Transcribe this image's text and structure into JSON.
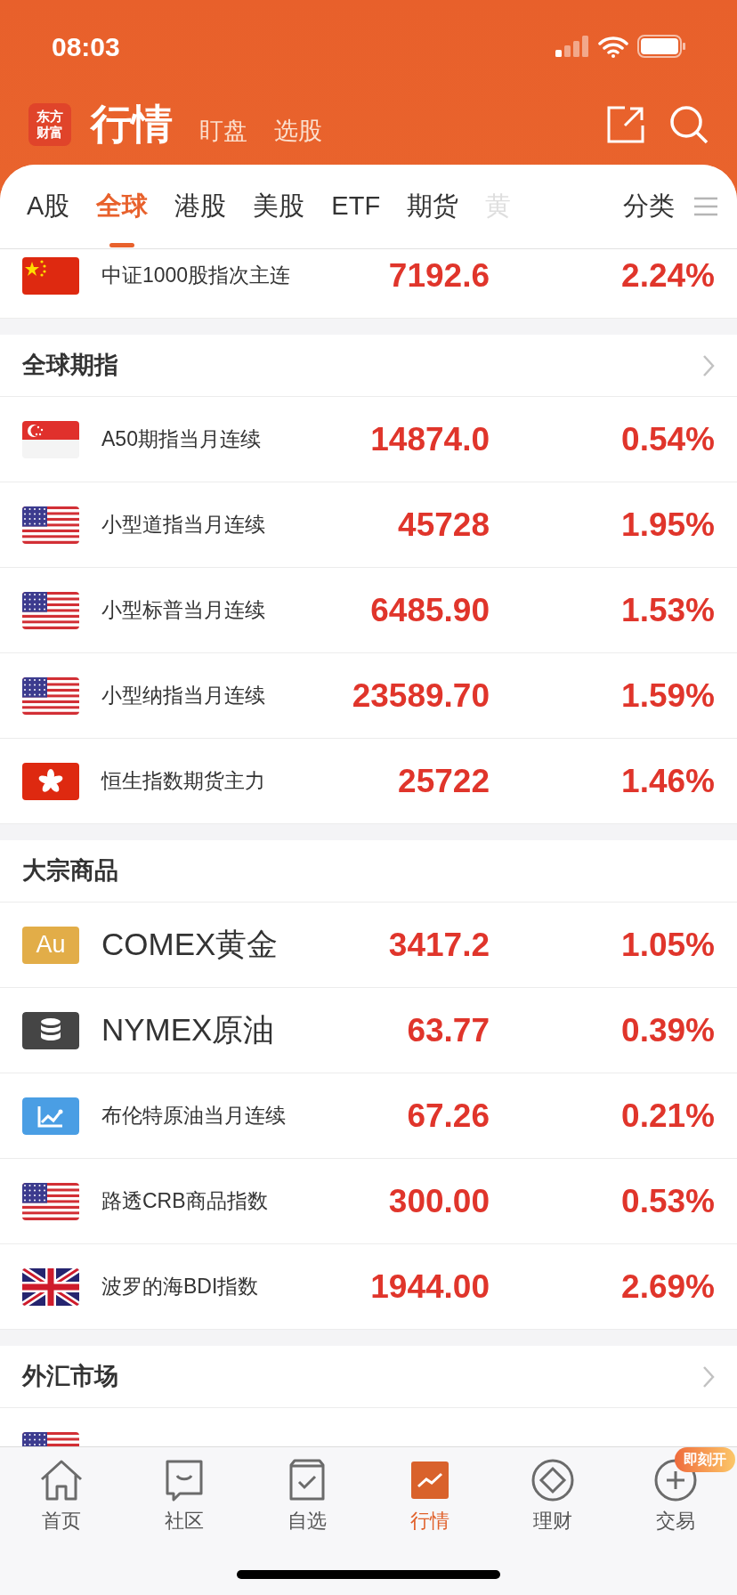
{
  "status_bar": {
    "time": "08:03"
  },
  "header": {
    "logo": [
      "东方",
      "财富"
    ],
    "title": "行情",
    "links": [
      "盯盘",
      "选股"
    ]
  },
  "tabs": [
    {
      "label": "A股",
      "selected": false,
      "faded": false
    },
    {
      "label": "全球",
      "selected": true,
      "faded": false
    },
    {
      "label": "港股",
      "selected": false,
      "faded": false
    },
    {
      "label": "美股",
      "selected": false,
      "faded": false
    },
    {
      "label": "ETF",
      "selected": false,
      "faded": false
    },
    {
      "label": "期货",
      "selected": false,
      "faded": false
    },
    {
      "label": "黄",
      "selected": false,
      "faded": true
    }
  ],
  "category_tab": "分类",
  "sections": [
    {
      "rows": [
        {
          "kind": "cn",
          "name": "中证1000股指次主连",
          "price": "7192.6",
          "change": "2.24%",
          "large_name": false
        }
      ]
    },
    {
      "title": "全球期指",
      "has_arrow": true,
      "rows": [
        {
          "kind": "sg",
          "name": "A50期指当月连续",
          "price": "14874.0",
          "change": "0.54%",
          "large_name": false
        },
        {
          "kind": "us",
          "name": "小型道指当月连续",
          "price": "45728",
          "change": "1.95%",
          "large_name": false
        },
        {
          "kind": "us",
          "name": "小型标普当月连续",
          "price": "6485.90",
          "change": "1.53%",
          "large_name": false
        },
        {
          "kind": "us",
          "name": "小型纳指当月连续",
          "price": "23589.70",
          "change": "1.59%",
          "large_name": false
        },
        {
          "kind": "hk",
          "name": "恒生指数期货主力",
          "price": "25722",
          "change": "1.46%",
          "large_name": false
        }
      ]
    },
    {
      "title": "大宗商品",
      "has_arrow": false,
      "rows": [
        {
          "kind": "gold",
          "symbol": "Au",
          "name": "COMEX黄金",
          "price": "3417.2",
          "change": "1.05%",
          "large_name": true
        },
        {
          "kind": "oil",
          "name": "NYMEX原油",
          "price": "63.77",
          "change": "0.39%",
          "large_name": true
        },
        {
          "kind": "chart",
          "name": "布伦特原油当月连续",
          "price": "67.26",
          "change": "0.21%",
          "large_name": false
        },
        {
          "kind": "us",
          "name": "路透CRB商品指数",
          "price": "300.00",
          "change": "0.53%",
          "large_name": false
        },
        {
          "kind": "gb",
          "name": "波罗的海BDI指数",
          "price": "1944.00",
          "change": "2.69%",
          "large_name": false
        }
      ]
    },
    {
      "title": "外汇市场",
      "has_arrow": true,
      "rows": [
        {
          "kind": "us"
        }
      ]
    }
  ],
  "nav": [
    {
      "kind": "home",
      "label": "首页",
      "selected": false
    },
    {
      "kind": "chat",
      "label": "社区",
      "selected": false
    },
    {
      "kind": "check",
      "label": "自选",
      "selected": false
    },
    {
      "kind": "market",
      "label": "行情",
      "selected": true
    },
    {
      "kind": "diamond",
      "label": "理财",
      "selected": false
    },
    {
      "kind": "plus",
      "label": "交易",
      "selected": false,
      "badge": "即刻开"
    }
  ]
}
